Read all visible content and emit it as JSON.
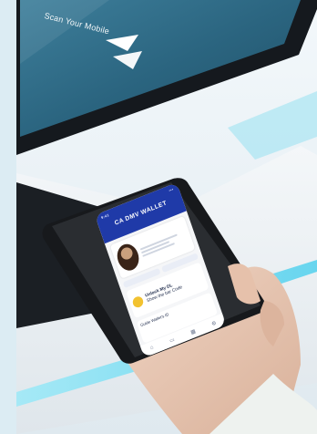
{
  "kiosk": {
    "screen_text": "Scan Your Mobile"
  },
  "phone_app": {
    "status_time": "9:41",
    "status_icons": "•••",
    "header_title": "CA DMV WALLET",
    "promo_title": "Unlock My DL",
    "promo_title_2": "Show the bar Code",
    "welcome_text": "Guide Wallet's ID",
    "tab_icons": [
      "home-icon",
      "wallet-icon",
      "qr-icon",
      "settings-icon"
    ]
  },
  "colors": {
    "kiosk_frame": "#15191e",
    "kiosk_screen": "#2e6a86",
    "app_header": "#1f3aa8",
    "counter_glow": "#7fe0f4"
  }
}
